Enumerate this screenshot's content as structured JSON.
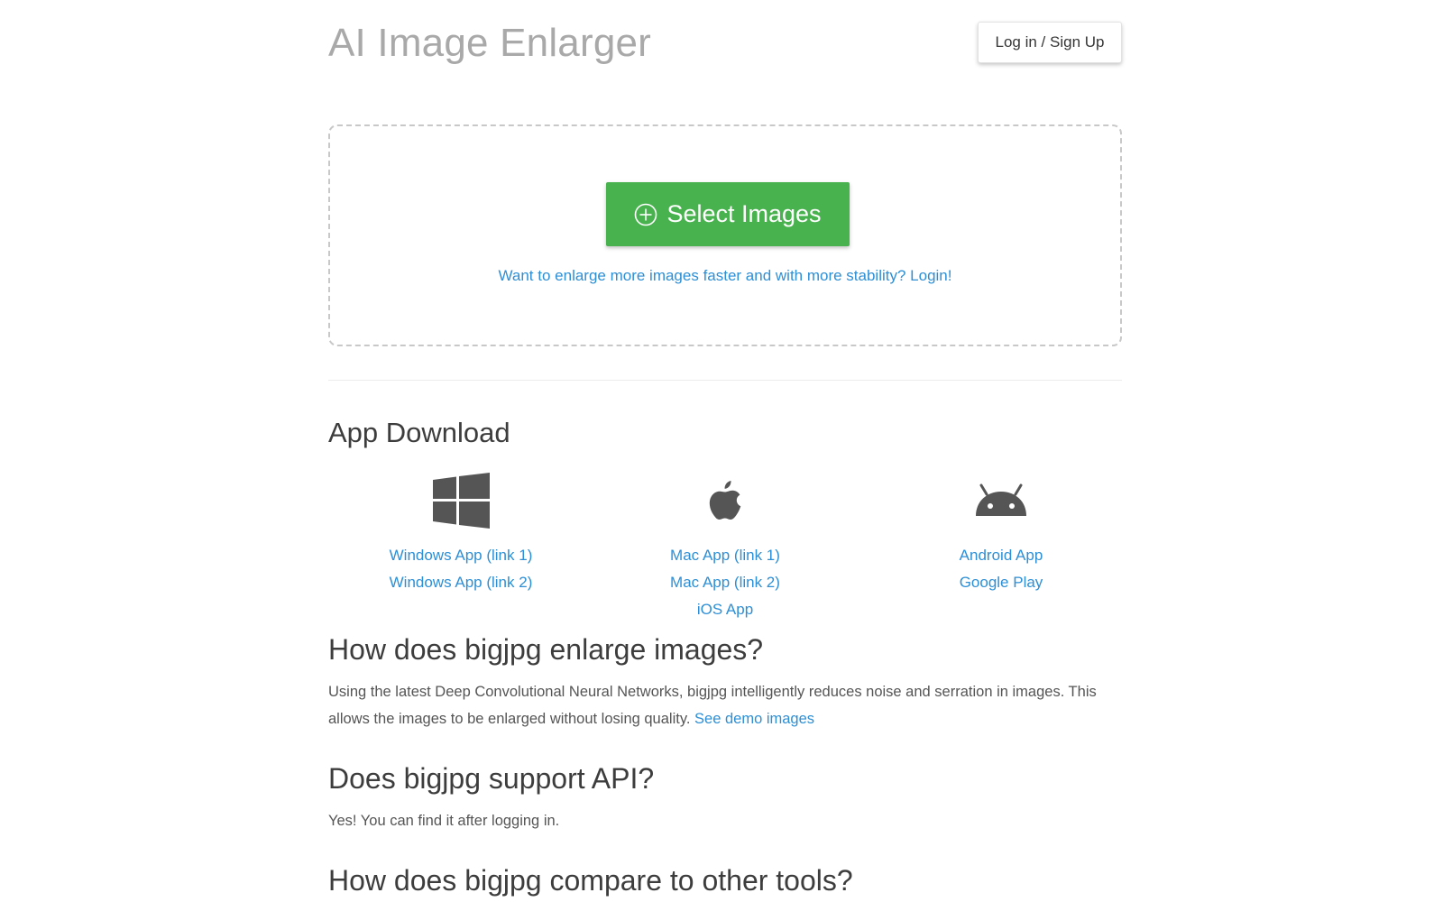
{
  "header": {
    "title": "AI Image Enlarger",
    "login_label": "Log in / Sign Up"
  },
  "upload": {
    "select_label": "Select Images",
    "login_hint": "Want to enlarge more images faster and with more stability? Login!"
  },
  "apps": {
    "heading": "App Download",
    "windows": {
      "icon": "windows-icon",
      "links": [
        "Windows App (link 1)",
        "Windows App (link 2)"
      ]
    },
    "mac": {
      "icon": "apple-icon",
      "links": [
        "Mac App (link 1)",
        "Mac App (link 2)",
        "iOS App"
      ]
    },
    "android": {
      "icon": "android-icon",
      "links": [
        "Android App",
        "Google Play"
      ]
    }
  },
  "faq": {
    "q1": {
      "heading": "How does bigjpg enlarge images?",
      "text": "Using the latest Deep Convolutional Neural Networks, bigjpg intelligently reduces noise and serration in images. This allows the images to be enlarged without losing quality.",
      "link": "See demo images"
    },
    "q2": {
      "heading": "Does bigjpg support API?",
      "text": "Yes! You can find it after logging in."
    },
    "q3": {
      "heading": "How does bigjpg compare to other tools?"
    }
  },
  "colors": {
    "accent_green": "#48b24f",
    "link_blue": "#2d8fd6",
    "title_gray": "#a9a9a9",
    "icon_gray": "#555555"
  }
}
